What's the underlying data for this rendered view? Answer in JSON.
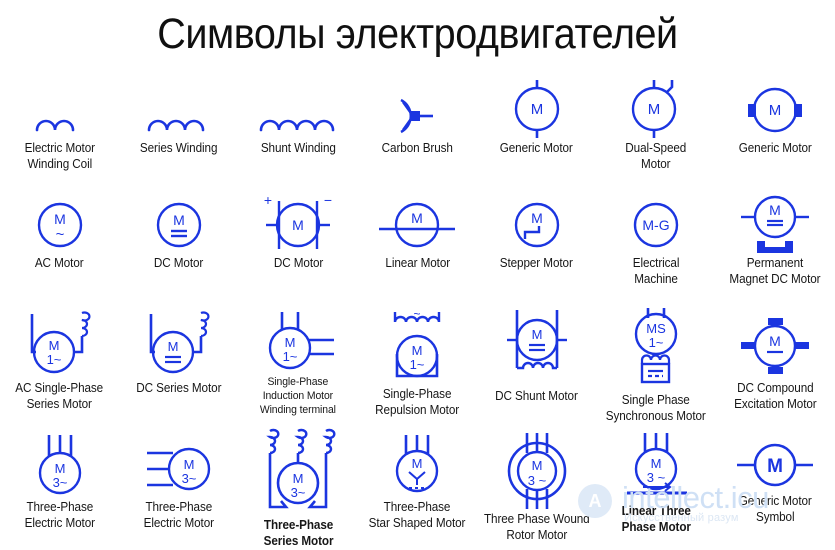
{
  "title": "Символы электродвигателей",
  "colors": {
    "symbol_blue": "#1b35e0",
    "label_text": "#171717",
    "title_text": "#101010",
    "watermark": "#cfe0f5"
  },
  "watermark": {
    "text": "intellect.icu",
    "subtitle": "Искусственный разум",
    "logo_glyph": "A"
  },
  "rows": [
    {
      "cells": [
        {
          "name": "electric-motor-winding-coil",
          "label": "Electric Motor\nWinding Coil",
          "icon": "coil-2"
        },
        {
          "name": "series-winding",
          "label": "Series Winding",
          "icon": "coil-3"
        },
        {
          "name": "shunt-winding",
          "label": "Shunt Winding",
          "icon": "coil-4"
        },
        {
          "name": "carbon-brush",
          "label": "Carbon Brush",
          "icon": "carbon-brush"
        },
        {
          "name": "generic-motor",
          "label": "Generic Motor",
          "icon": "motor-m-vertical-leads",
          "inner": "M"
        },
        {
          "name": "dual-speed-motor",
          "label": "Dual-Speed\nMotor",
          "icon": "motor-dual-speed",
          "inner": "M"
        },
        {
          "name": "generic-motor-terminals",
          "label": "Generic Motor",
          "icon": "motor-side-terminals",
          "inner": "M"
        }
      ]
    },
    {
      "cells": [
        {
          "name": "ac-motor",
          "label": "AC Motor",
          "icon": "motor-ac",
          "inner": "M",
          "inner2": "~"
        },
        {
          "name": "dc-motor",
          "label": "DC Motor",
          "icon": "motor-dc",
          "inner": "M",
          "inner2": "="
        },
        {
          "name": "dc-motor-brushes",
          "label": "DC Motor",
          "icon": "motor-dc-brushes",
          "inner": "M",
          "plus": "+",
          "minus": "−"
        },
        {
          "name": "linear-motor",
          "label": "Linear Motor",
          "icon": "motor-linear",
          "inner": "M"
        },
        {
          "name": "stepper-motor",
          "label": "Stepper Motor",
          "icon": "motor-stepper",
          "inner": "M"
        },
        {
          "name": "electrical-machine",
          "label": "Electrical\nMachine",
          "icon": "motor-mg",
          "inner": "M-G"
        },
        {
          "name": "permanent-magnet-dc-motor",
          "label": "Permanent\nMagnet DC Motor",
          "icon": "motor-permanent-magnet",
          "inner": "M"
        }
      ]
    },
    {
      "cells": [
        {
          "name": "ac-single-phase-series-motor",
          "label": "AC Single-Phase\nSeries Motor",
          "icon": "motor-series-ac",
          "inner": "M",
          "inner2": "1~"
        },
        {
          "name": "dc-series-motor",
          "label": "DC Series Motor",
          "icon": "motor-series-dc",
          "inner": "M",
          "inner2": "="
        },
        {
          "name": "single-phase-induction-motor",
          "label": "Single-Phase\nInduction Motor\nWinding terminal",
          "icon": "motor-induction-1ph",
          "inner": "M",
          "inner2": "1~",
          "small": true
        },
        {
          "name": "single-phase-repulsion-motor",
          "label": "Single-Phase\nRepulsion Motor",
          "icon": "motor-repulsion",
          "inner": "M",
          "inner2": "1~"
        },
        {
          "name": "dc-shunt-motor",
          "label": "DC Shunt Motor",
          "icon": "motor-shunt-dc",
          "inner": "M",
          "inner2": "="
        },
        {
          "name": "single-phase-synchronous-motor",
          "label": "Single Phase\nSynchronous Motor",
          "icon": "motor-synchronous",
          "inner": "MS",
          "inner2": "1~"
        },
        {
          "name": "dc-compound-excitation-motor",
          "label": "DC Compound\nExcitation Motor",
          "icon": "motor-compound",
          "inner": "M"
        }
      ]
    },
    {
      "cells": [
        {
          "name": "three-phase-electric-motor-top-leads",
          "label": "Three-Phase\nElectric Motor",
          "icon": "motor-3ph-top",
          "inner": "M",
          "inner2": "3~"
        },
        {
          "name": "three-phase-electric-motor-side-leads",
          "label": "Three-Phase\nElectric Motor",
          "icon": "motor-3ph-side",
          "inner": "M",
          "inner2": "3~"
        },
        {
          "name": "three-phase-series-motor",
          "label": "Three-Phase\nSeries Motor",
          "icon": "motor-3ph-series",
          "inner": "M",
          "inner2": "3~",
          "bold": true
        },
        {
          "name": "three-phase-star-shaped-motor",
          "label": "Three-Phase\nStar Shaped Motor",
          "icon": "motor-3ph-star",
          "inner": "M"
        },
        {
          "name": "three-phase-wound-rotor-motor",
          "label": "Three Phase Wound\nRotor Motor",
          "icon": "motor-wound-rotor",
          "inner": "M",
          "inner2": "3 ~"
        },
        {
          "name": "linear-three-phase-motor",
          "label": "Linear Three\nPhase Motor",
          "icon": "motor-linear-3ph",
          "inner": "M",
          "inner2": "3 ~",
          "bold": true
        },
        {
          "name": "generic-motor-symbol",
          "label": "Generic Motor\nSymbol",
          "icon": "motor-generic-bold",
          "inner": "M"
        }
      ]
    }
  ]
}
